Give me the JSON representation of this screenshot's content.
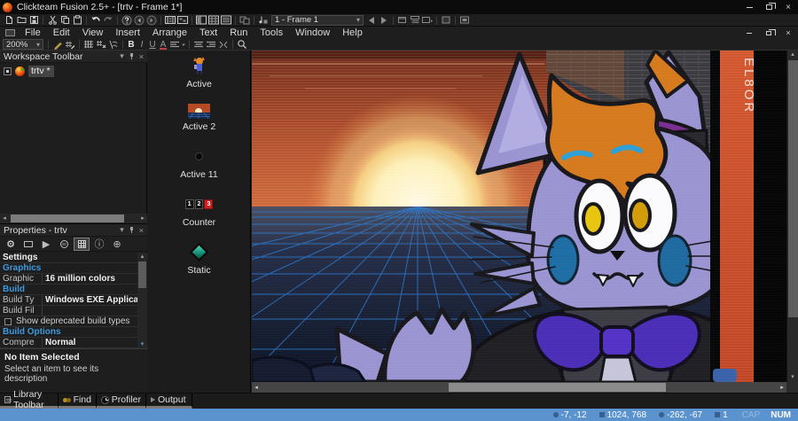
{
  "window": {
    "title": "Clickteam Fusion 2.5+ - [trtv - Frame 1*]"
  },
  "menubar": {
    "items": [
      "File",
      "Edit",
      "View",
      "Insert",
      "Arrange",
      "Text",
      "Run",
      "Tools",
      "Window",
      "Help"
    ]
  },
  "toolbar": {
    "frame_selector": "1 - Frame 1",
    "zoom_level": "200%",
    "bold": "B",
    "italic": "I",
    "underline": "U",
    "font_color": "A"
  },
  "workspace_panel": {
    "title": "Workspace Toolbar",
    "project": "trtv *"
  },
  "objects_panel": {
    "items": [
      {
        "label": "Active"
      },
      {
        "label": "Active 2"
      },
      {
        "label": "Active 11"
      },
      {
        "label": "Counter",
        "digits": [
          "1",
          "2",
          "3"
        ]
      },
      {
        "label": "Static"
      }
    ]
  },
  "properties_panel": {
    "title": "Properties - trtv",
    "rows": [
      {
        "label": "Settings"
      },
      {
        "label": "Graphics"
      },
      {
        "label": "Graphic",
        "value": "16 million colors"
      },
      {
        "label": "Build"
      },
      {
        "label": "Build Ty",
        "value": "Windows EXE Application"
      },
      {
        "label": "Build Fil",
        "value": ""
      },
      {
        "label": "Show deprecated build types"
      },
      {
        "label": "Build Options"
      },
      {
        "label": "Compre",
        "value": "Normal"
      }
    ],
    "description_title": "No Item Selected",
    "description_text": "Select an item to see its description"
  },
  "canvas": {
    "overlay_text": "EL8OR"
  },
  "bottom_tabs": {
    "items": [
      "Library Toolbar",
      "Find",
      "Profiler",
      "Output"
    ]
  },
  "status_bar": {
    "mouse_position": "-7, -12",
    "frame_size": "1024, 768",
    "scroll_position": "-262, -67",
    "layer": "1",
    "caps_indicator": "CAP",
    "num_indicator": "NUM"
  },
  "colors": {
    "statusbar_accent": "#5b93ce",
    "selection": "#454545",
    "section_blue": "#3e9ade"
  }
}
